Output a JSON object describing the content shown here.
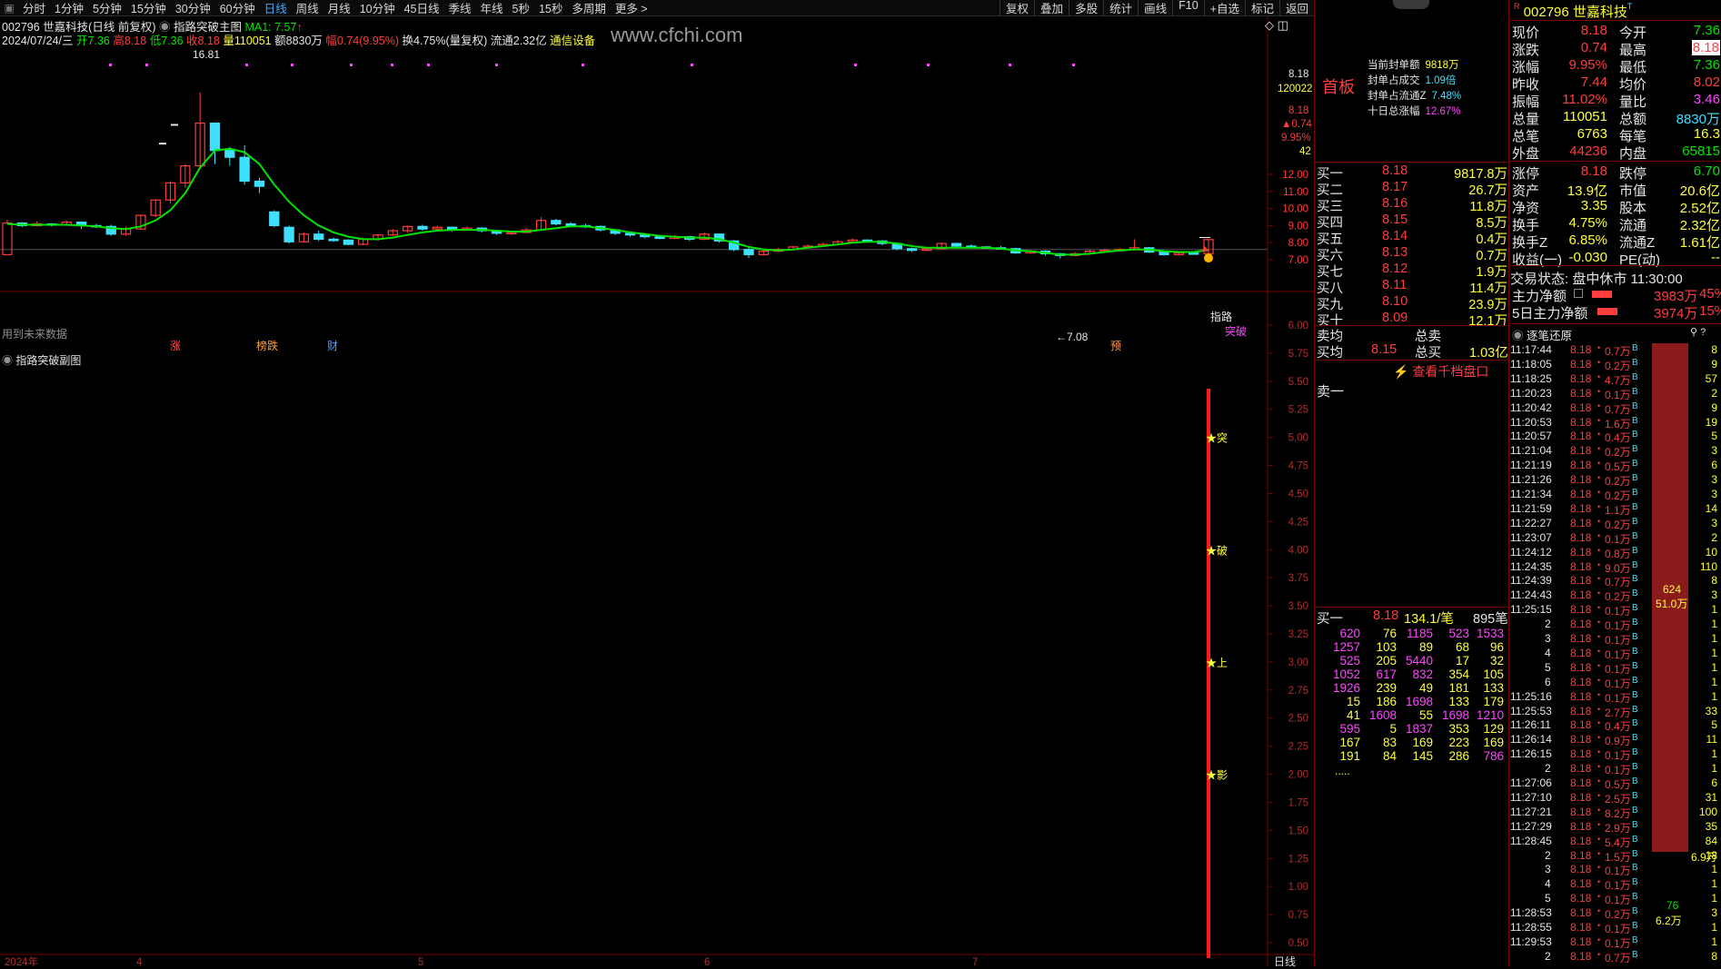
{
  "topbar": {
    "tabs": [
      "分时",
      "1分钟",
      "5分钟",
      "15分钟",
      "30分钟",
      "60分钟",
      "日线",
      "周线",
      "月线",
      "10分钟",
      "45日线",
      "季线",
      "年线",
      "5秒",
      "15秒",
      "多周期",
      "更多 >"
    ],
    "active_tab": "日线",
    "tools": [
      "复权",
      "叠加",
      "多股",
      "统计",
      "画线",
      "F10",
      "+自选",
      "标记",
      "返回"
    ]
  },
  "chart_header": {
    "line1": {
      "code_name": "002796 世嘉科技(日线 前复权)",
      "indicator": "指路突破主图",
      "ma": "MA1: 7.57",
      "arrow": "↑"
    },
    "line2": {
      "date": "2024/07/24/三",
      "open": "开7.36",
      "high": "高8.18",
      "low": "低7.36",
      "close": "收8.18",
      "vol": "量110051",
      "amount": "额8830万",
      "change": "幅0.74(9.95%)",
      "turnover": "换4.75%(量复权)",
      "float": "流通2.32亿",
      "industry": "通信设备"
    },
    "watermark": "www.cfchi.com"
  },
  "main_chart": {
    "annotations": {
      "peak": "16.81",
      "low": "←7.08",
      "future_data": "用到未来数据",
      "signal_label": "指路",
      "breakout_label": "突破",
      "bottom_tags": [
        "涨",
        "榜跌",
        "财",
        "预"
      ]
    },
    "axis_labels": [
      "12.00",
      "11.00",
      "10.00",
      "9.00",
      "8.00",
      "7.00"
    ],
    "axis_top": {
      "price": "8.18",
      "vol": "120022",
      "price2": "8.18",
      "chg": "▲0.74",
      "pct": "9.95%",
      "n": "42"
    },
    "candles": [
      [
        7.3,
        9.15,
        9.35,
        9.1
      ],
      [
        9.15,
        9.0,
        9.2,
        8.9
      ],
      [
        9.0,
        9.1,
        9.25,
        8.95
      ],
      [
        9.1,
        9.05,
        9.15,
        8.95
      ],
      [
        9.05,
        9.2,
        9.3,
        9.0
      ],
      [
        9.2,
        9.0,
        9.25,
        8.8
      ],
      [
        9.0,
        8.95,
        9.1,
        8.85
      ],
      [
        8.95,
        8.5,
        9.05,
        8.4
      ],
      [
        8.5,
        8.8,
        8.95,
        8.4
      ],
      [
        8.8,
        9.6,
        9.65,
        8.75
      ],
      [
        9.6,
        10.5,
        10.55,
        9.5
      ],
      [
        10.5,
        11.5,
        11.6,
        10.3
      ],
      [
        11.5,
        12.5,
        12.6,
        11.2
      ],
      [
        12.5,
        15.0,
        16.81,
        12.3
      ],
      [
        15.0,
        13.4,
        14.0,
        12.6
      ],
      [
        13.4,
        13.0,
        13.6,
        12.5
      ],
      [
        13.0,
        11.6,
        13.7,
        11.4
      ],
      [
        11.6,
        11.3,
        11.8,
        10.9
      ],
      [
        9.8,
        9.0,
        9.9,
        8.9
      ],
      [
        8.9,
        8.05,
        9.0,
        7.95
      ],
      [
        8.05,
        8.5,
        8.6,
        8.0
      ],
      [
        8.5,
        8.2,
        8.7,
        8.1
      ],
      [
        8.2,
        8.15,
        8.3,
        8.05
      ],
      [
        8.15,
        7.9,
        8.2,
        7.85
      ],
      [
        7.9,
        8.2,
        8.3,
        7.85
      ],
      [
        8.2,
        8.45,
        8.5,
        8.1
      ],
      [
        8.45,
        8.7,
        8.8,
        8.4
      ],
      [
        8.7,
        8.95,
        9.0,
        8.6
      ],
      [
        8.95,
        8.8,
        9.05,
        8.7
      ],
      [
        8.8,
        8.9,
        9.0,
        8.75
      ],
      [
        8.9,
        8.75,
        8.95,
        8.65
      ],
      [
        8.75,
        8.85,
        8.95,
        8.7
      ],
      [
        8.85,
        8.7,
        8.9,
        8.6
      ],
      [
        8.7,
        8.55,
        8.75,
        8.45
      ],
      [
        8.55,
        8.6,
        8.7,
        8.45
      ],
      [
        8.6,
        8.75,
        8.85,
        8.55
      ],
      [
        8.75,
        9.3,
        9.5,
        8.7
      ],
      [
        9.3,
        9.1,
        9.4,
        9.0
      ],
      [
        9.1,
        9.0,
        9.2,
        8.9
      ],
      [
        9.0,
        8.95,
        9.1,
        8.85
      ],
      [
        8.95,
        8.75,
        9.0,
        8.65
      ],
      [
        8.75,
        8.55,
        8.8,
        8.45
      ],
      [
        8.55,
        8.45,
        8.6,
        8.35
      ],
      [
        8.45,
        8.35,
        8.5,
        8.25
      ],
      [
        8.35,
        8.25,
        8.45,
        8.2
      ],
      [
        8.25,
        8.35,
        8.45,
        8.2
      ],
      [
        8.35,
        8.2,
        8.4,
        8.1
      ],
      [
        8.2,
        8.5,
        8.6,
        8.15
      ],
      [
        8.5,
        8.1,
        8.55,
        8.0
      ],
      [
        8.1,
        7.6,
        8.15,
        7.5
      ],
      [
        7.6,
        7.3,
        7.7,
        7.1
      ],
      [
        7.3,
        7.5,
        7.6,
        7.25
      ],
      [
        7.5,
        7.6,
        7.7,
        7.45
      ],
      [
        7.6,
        7.75,
        7.8,
        7.55
      ],
      [
        7.75,
        7.8,
        7.9,
        7.7
      ],
      [
        7.8,
        7.9,
        8.0,
        7.75
      ],
      [
        7.9,
        8.05,
        8.15,
        7.85
      ],
      [
        8.05,
        8.15,
        8.25,
        8.0
      ],
      [
        8.15,
        8.1,
        8.2,
        8.0
      ],
      [
        8.1,
        7.95,
        8.15,
        7.85
      ],
      [
        7.95,
        7.65,
        8.0,
        7.55
      ],
      [
        7.65,
        7.55,
        7.7,
        7.45
      ],
      [
        7.55,
        7.65,
        7.75,
        7.5
      ],
      [
        7.65,
        7.95,
        8.0,
        7.6
      ],
      [
        7.95,
        7.8,
        8.0,
        7.7
      ],
      [
        7.8,
        7.75,
        7.9,
        7.7
      ],
      [
        7.75,
        7.7,
        7.8,
        7.65
      ],
      [
        7.7,
        7.65,
        7.8,
        7.6
      ],
      [
        7.65,
        7.4,
        7.7,
        7.35
      ],
      [
        7.4,
        7.5,
        7.55,
        7.35
      ],
      [
        7.5,
        7.35,
        7.55,
        7.25
      ],
      [
        7.35,
        7.25,
        7.4,
        7.08
      ],
      [
        7.25,
        7.35,
        7.45,
        7.2
      ],
      [
        7.35,
        7.5,
        7.6,
        7.3
      ],
      [
        7.5,
        7.55,
        7.65,
        7.45
      ],
      [
        7.55,
        7.6,
        7.7,
        7.5
      ],
      [
        7.6,
        7.7,
        8.2,
        7.55
      ],
      [
        7.7,
        7.45,
        7.75,
        7.4
      ],
      [
        7.45,
        7.3,
        7.5,
        7.25
      ],
      [
        7.3,
        7.4,
        7.5,
        7.25
      ],
      [
        7.4,
        7.36,
        7.45,
        7.3
      ],
      [
        7.36,
        8.18,
        8.18,
        7.36
      ]
    ],
    "ma_line": [
      9.1,
      9.05,
      9.05,
      9.05,
      9.05,
      9.0,
      8.95,
      8.85,
      8.8,
      8.95,
      9.3,
      9.9,
      10.9,
      12.4,
      13.4,
      13.5,
      13.3,
      12.6,
      11.4,
      10.4,
      9.6,
      9.0,
      8.6,
      8.35,
      8.2,
      8.2,
      8.3,
      8.45,
      8.6,
      8.7,
      8.75,
      8.75,
      8.75,
      8.7,
      8.65,
      8.65,
      8.75,
      8.85,
      8.95,
      8.95,
      8.85,
      8.75,
      8.6,
      8.5,
      8.4,
      8.35,
      8.3,
      8.3,
      8.2,
      8.0,
      7.75,
      7.6,
      7.55,
      7.6,
      7.7,
      7.8,
      7.9,
      8.0,
      8.05,
      8.05,
      7.95,
      7.8,
      7.7,
      7.7,
      7.7,
      7.7,
      7.7,
      7.65,
      7.55,
      7.5,
      7.4,
      7.3,
      7.3,
      7.35,
      7.45,
      7.55,
      7.6,
      7.6,
      7.5,
      7.45,
      7.45,
      7.57
    ]
  },
  "sub_chart": {
    "title": "指路突破副图",
    "axis_labels": [
      "6.00",
      "5.75",
      "5.50",
      "5.25",
      "5.00",
      "4.75",
      "4.50",
      "4.25",
      "4.00",
      "3.75",
      "3.50",
      "3.25",
      "3.00",
      "2.75",
      "2.50",
      "2.25",
      "2.00",
      "1.75",
      "1.50",
      "1.25",
      "1.00",
      "0.75",
      "0.50"
    ],
    "star_labels": [
      "突",
      "破",
      "上",
      "影"
    ],
    "x_labels": [
      "2024年",
      "4",
      "5",
      "6",
      "7"
    ],
    "period": "日线"
  },
  "stock": {
    "code": "002796",
    "name": "世嘉科技",
    "badge": "首板"
  },
  "seal_info": [
    {
      "label": "当前封单额",
      "value": "9818万"
    },
    {
      "label": "封单占成交",
      "value": "1.09倍"
    },
    {
      "label": "封单占流通Z",
      "value": "7.48%"
    },
    {
      "label": "十日总涨幅",
      "value": "12.67%"
    }
  ],
  "order_book": {
    "bids": [
      {
        "label": "买一",
        "price": "8.18",
        "vol": "9817.8万"
      },
      {
        "label": "买二",
        "price": "8.17",
        "vol": "26.7万"
      },
      {
        "label": "买三",
        "price": "8.16",
        "vol": "11.8万"
      },
      {
        "label": "买四",
        "price": "8.15",
        "vol": "8.5万"
      },
      {
        "label": "买五",
        "price": "8.14",
        "vol": "0.4万"
      },
      {
        "label": "买六",
        "price": "8.13",
        "vol": "0.7万"
      },
      {
        "label": "买七",
        "price": "8.12",
        "vol": "1.9万"
      },
      {
        "label": "买八",
        "price": "8.11",
        "vol": "11.4万"
      },
      {
        "label": "买九",
        "price": "8.10",
        "vol": "23.9万"
      },
      {
        "label": "买十",
        "price": "8.09",
        "vol": "12.1万"
      }
    ],
    "sell_avg_label": "卖均",
    "total_sell_label": "总卖",
    "buy_avg_label": "买均",
    "buy_avg": "8.15",
    "total_buy_label": "总买",
    "total_buy": "1.03亿",
    "link": "查看千档盘口",
    "sell1_label": "卖一"
  },
  "queue": {
    "label": "买一",
    "price": "8.18",
    "avg": "134.1/笔",
    "count": "895笔",
    "rows": [
      [
        "620",
        "76",
        "1185",
        "523",
        "1533"
      ],
      [
        "1257",
        "103",
        "89",
        "68",
        "96"
      ],
      [
        "525",
        "205",
        "5440",
        "17",
        "32"
      ],
      [
        "1052",
        "617",
        "832",
        "354",
        "105"
      ],
      [
        "1926",
        "239",
        "49",
        "181",
        "133"
      ],
      [
        "15",
        "186",
        "1698",
        "133",
        "179"
      ],
      [
        "41",
        "1608",
        "55",
        "1698",
        "1210"
      ],
      [
        "595",
        "5",
        "1837",
        "353",
        "129"
      ],
      [
        "167",
        "83",
        "169",
        "223",
        "169"
      ],
      [
        "191",
        "84",
        "145",
        "286",
        "786"
      ]
    ],
    "more": "....."
  },
  "quote": {
    "title": "002796 世嘉科技",
    "rows": [
      [
        "现价",
        "8.18",
        "今开",
        "7.36"
      ],
      [
        "涨跌",
        "0.74",
        "最高",
        "8.18"
      ],
      [
        "涨幅",
        "9.95%",
        "最低",
        "7.36"
      ],
      [
        "昨收",
        "7.44",
        "均价",
        "8.02"
      ],
      [
        "振幅",
        "11.02%",
        "量比",
        "3.46"
      ],
      [
        "总量",
        "110051",
        "总额",
        "8830万"
      ],
      [
        "总笔",
        "6763",
        "每笔",
        "16.3"
      ],
      [
        "外盘",
        "44236",
        "内盘",
        "65815"
      ]
    ],
    "rows2": [
      [
        "涨停",
        "8.18",
        "跌停",
        "6.70"
      ],
      [
        "资产",
        "13.9亿",
        "市值",
        "20.6亿"
      ],
      [
        "净资",
        "3.35",
        "股本",
        "2.52亿"
      ],
      [
        "换手",
        "4.75%",
        "流通",
        "2.32亿"
      ],
      [
        "换手Z",
        "6.85%",
        "流通Z",
        "1.61亿"
      ],
      [
        "收益(一)",
        "-0.030",
        "PE(动)",
        "--"
      ]
    ],
    "trade_status": "交易状态: 盘中休市 11:30:00",
    "main_net": {
      "label": "主力净额",
      "value": "3983万",
      "pct": "45%"
    },
    "main_net5": {
      "label": "5日主力净额",
      "value": "3974万",
      "pct": "15%"
    }
  },
  "ticks": {
    "title": "逐笔还原",
    "rows": [
      [
        "11:17:44",
        "8.18",
        "0.7万",
        "8"
      ],
      [
        "11:18:05",
        "8.18",
        "0.2万",
        "9"
      ],
      [
        "11:18:25",
        "8.18",
        "4.7万",
        "57"
      ],
      [
        "11:20:23",
        "8.18",
        "0.1万",
        "2"
      ],
      [
        "11:20:42",
        "8.18",
        "0.7万",
        "9"
      ],
      [
        "11:20:53",
        "8.18",
        "1.6万",
        "19"
      ],
      [
        "11:20:57",
        "8.18",
        "0.4万",
        "5"
      ],
      [
        "11:21:04",
        "8.18",
        "0.2万",
        "3"
      ],
      [
        "11:21:19",
        "8.18",
        "0.5万",
        "6"
      ],
      [
        "11:21:26",
        "8.18",
        "0.2万",
        "3"
      ],
      [
        "11:21:34",
        "8.18",
        "0.2万",
        "3"
      ],
      [
        "11:21:59",
        "8.18",
        "1.1万",
        "14"
      ],
      [
        "11:22:27",
        "8.18",
        "0.2万",
        "3"
      ],
      [
        "11:23:07",
        "8.18",
        "0.1万",
        "2"
      ],
      [
        "11:24:12",
        "8.18",
        "0.8万",
        "10"
      ],
      [
        "11:24:35",
        "8.18",
        "9.0万",
        "110"
      ],
      [
        "11:24:39",
        "8.18",
        "0.7万",
        "8"
      ],
      [
        "11:24:43",
        "8.18",
        "0.2万",
        "3"
      ],
      [
        "11:25:15",
        "8.18",
        "0.1万",
        "1"
      ],
      [
        "2",
        "8.18",
        "0.1万",
        "1"
      ],
      [
        "3",
        "8.18",
        "0.1万",
        "1"
      ],
      [
        "4",
        "8.18",
        "0.1万",
        "1"
      ],
      [
        "5",
        "8.18",
        "0.1万",
        "1"
      ],
      [
        "6",
        "8.18",
        "0.1万",
        "1"
      ],
      [
        "11:25:16",
        "8.18",
        "0.1万",
        "1"
      ],
      [
        "11:25:53",
        "8.18",
        "2.7万",
        "33"
      ],
      [
        "11:26:11",
        "8.18",
        "0.4万",
        "5"
      ],
      [
        "11:26:14",
        "8.18",
        "0.9万",
        "11"
      ],
      [
        "11:26:15",
        "8.18",
        "0.1万",
        "1"
      ],
      [
        "2",
        "8.18",
        "0.1万",
        "1"
      ],
      [
        "11:27:06",
        "8.18",
        "0.5万",
        "6"
      ],
      [
        "11:27:10",
        "8.18",
        "2.5万",
        "31"
      ],
      [
        "11:27:21",
        "8.18",
        "8.2万",
        "100"
      ],
      [
        "11:27:29",
        "8.18",
        "2.9万",
        "35"
      ],
      [
        "11:28:45",
        "8.18",
        "5.4万",
        "84"
      ],
      [
        "2",
        "8.18",
        "1.5万",
        "18"
      ],
      [
        "3",
        "8.18",
        "0.1万",
        "1"
      ],
      [
        "4",
        "8.18",
        "0.1万",
        "1"
      ],
      [
        "5",
        "8.18",
        "0.1万",
        "1"
      ],
      [
        "11:28:53",
        "8.18",
        "0.2万",
        "3"
      ],
      [
        "11:28:55",
        "8.18",
        "0.1万",
        "1"
      ],
      [
        "11:29:53",
        "8.18",
        "0.1万",
        "1"
      ],
      [
        "2",
        "8.18",
        "0.7万",
        "8"
      ]
    ],
    "bar_label1": "624",
    "bar_label2": "51.0万",
    "bar_label3": "76",
    "bar_label4": "6.2万",
    "side_label": "6.9万"
  },
  "colors": {
    "up": "#ff3d3d",
    "down": "#3fe0ff",
    "ma": "#00e400",
    "grid": "#7a0000",
    "bg": "#000000"
  }
}
